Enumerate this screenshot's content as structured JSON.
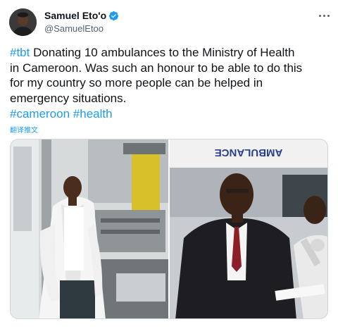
{
  "tweet": {
    "author": {
      "display_name": "Samuel Eto'o",
      "handle": "@SamuelEtoo",
      "verified": true,
      "avatar_icon": "user-avatar"
    },
    "text": {
      "tbt": "#tbt",
      "line1_rest": " Donating 10 ambulances to the Ministry of Health",
      "line2": "in Cameroon. Was such an honour to be able to do this",
      "line3": "for my country so more people can be helped in",
      "line4": "emergency situations.",
      "hashtag_cameroon": "#cameroon",
      "hashtag_health": "#health"
    },
    "translate_label": "翻译推文",
    "media": {
      "ambulance_sign": "AMBULANCE"
    },
    "colors": {
      "link": "#1d9bf0",
      "text": "#0f1419",
      "secondary": "#536471",
      "verified": "#1d9bf0"
    }
  }
}
